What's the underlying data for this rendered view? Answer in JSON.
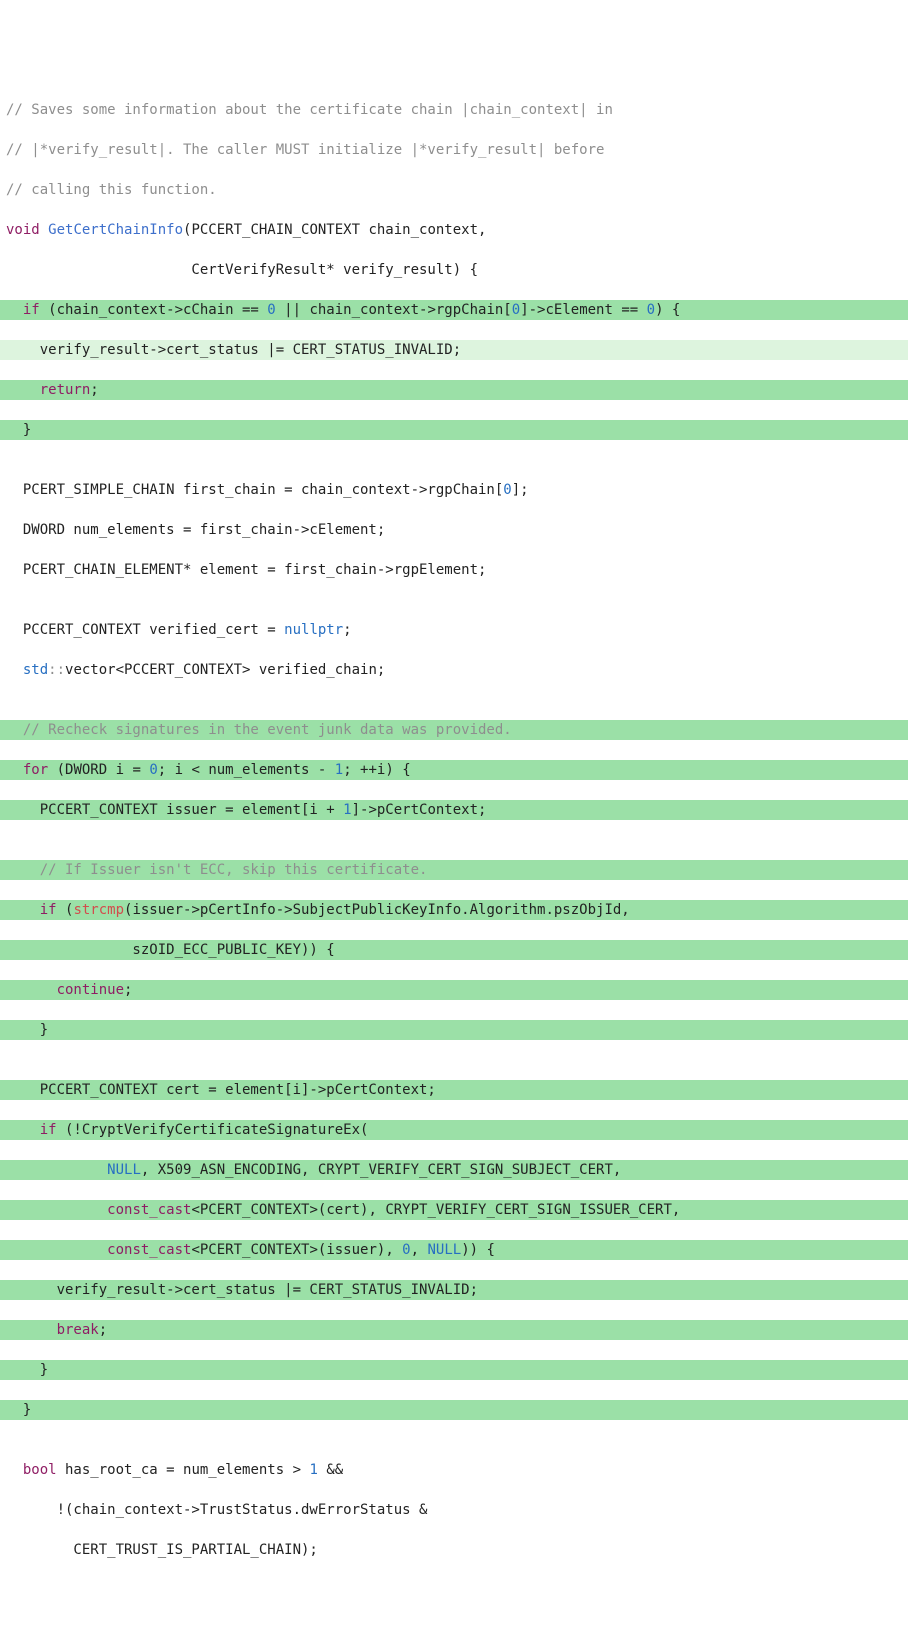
{
  "code": {
    "c1": "// Saves some information about the certificate chain |chain_context| in",
    "c2": "// |*verify_result|. The caller MUST initialize |*verify_result| before",
    "c3": "// calling this function.",
    "fn_ret": "void",
    "fn_name": "GetCertChainInfo",
    "fn_param_a": "(PCCERT_CHAIN_CONTEXT chain_context,",
    "fn_param_b": "                      CertVerifyResult* verify_result) {",
    "if1_kw": "if",
    "if1_a": " (chain_context->cChain == ",
    "zero": "0",
    "if1_b": " || chain_context->rgpChain[",
    "if1_c": "]->cElement == ",
    "if1_d": ") {",
    "stat_invalid": "    verify_result->cert_status |= CERT_STATUS_INVALID;",
    "ret_kw": "return",
    "semi": ";",
    "close_br": "  }",
    "blank": "",
    "l_simple": "  PCERT_SIMPLE_CHAIN first_chain = chain_context->rgpChain[",
    "l_simple_b": "];",
    "l_dword": "  DWORD num_elements = first_chain->cElement;",
    "l_elem": "  PCERT_CHAIN_ELEMENT* element = first_chain->rgpElement;",
    "l_verified_a": "  PCCERT_CONTEXT verified_cert = ",
    "nullptr": "nullptr",
    "l_vec_a": "std",
    "l_vec_b": "::",
    "l_vec_c": "vector",
    "l_vec_d": "<PCCERT_CONTEXT> verified_chain;",
    "c_recheck": "  // Recheck signatures in the event junk data was provided.",
    "for_kw": "for",
    "for_a": " (DWORD i = ",
    "for_b": "; i < num_elements - ",
    "one": "1",
    "for_c": "; ++i) {",
    "issuer_a": "    PCCERT_CONTEXT issuer = element[i + ",
    "issuer_b": "]->pCertContext;",
    "c_ecc": "    // If Issuer isn't ECC, skip this certificate.",
    "if2_kw": "if",
    "strcmp": "strcmp",
    "if2_a": " (",
    "if2_b": "(issuer->pCertInfo->SubjectPublicKeyInfo.Algorithm.pszObjId,",
    "if2_c": "               szOID_ECC_PUBLIC_KEY)) {",
    "cont_kw": "continue",
    "close_br2": "    }",
    "cert_line": "    PCCERT_CONTEXT cert = element[i]->pCertContext;",
    "if3_a": " (!CryptVerifyCertificateSignatureEx(",
    "vline1_a": "            ",
    "NULL": "NULL",
    "vline1_b": ", X509_ASN_ENCODING, CRYPT_VERIFY_CERT_SIGN_SUBJECT_CERT,",
    "const_cast": "const_cast",
    "vline2_a": "            ",
    "vline2_b": "<PCERT_CONTEXT>(cert), CRYPT_VERIFY_CERT_SIGN_ISSUER_CERT,",
    "vline3_a": "            ",
    "vline3_b": "<PCERT_CONTEXT>(issuer), ",
    "vline3_c": ", ",
    "vline3_d": ")) {",
    "stat_invalid2": "      verify_result->cert_status |= CERT_STATUS_INVALID;",
    "break_kw": "break",
    "bool_kw": "bool",
    "root_a": " has_root_ca = num_elements > ",
    "root_b": " &&",
    "root_c": "      !(chain_context->TrustStatus.dwErrorStatus &",
    "root_d": "        CERT_TRUST_IS_PARTIAL_CHAIN);"
  }
}
